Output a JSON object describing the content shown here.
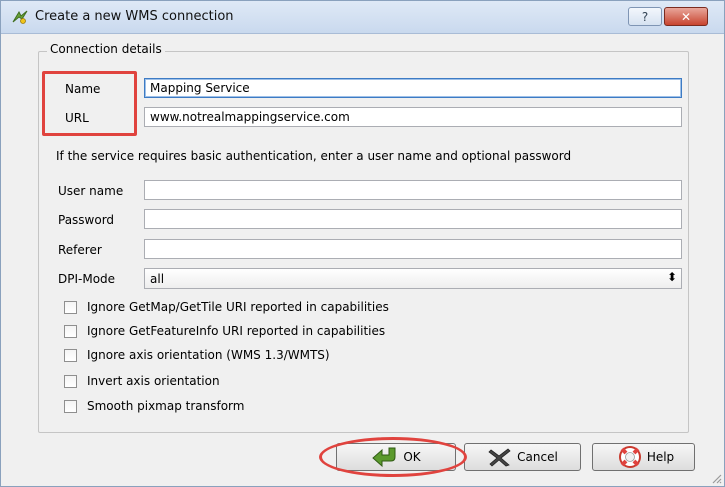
{
  "window": {
    "title": "Create a new WMS connection",
    "help_label": "?",
    "close_label": "✕"
  },
  "group": {
    "title": "Connection details"
  },
  "fields": {
    "name_label": "Name",
    "name_value": "Mapping Service",
    "url_label": "URL",
    "url_value": "www.notrealmappingservice.com",
    "auth_info": "If the service requires basic authentication, enter a user name and optional password",
    "username_label": "User name",
    "username_value": "",
    "password_label": "Password",
    "password_value": "",
    "referer_label": "Referer",
    "referer_value": "",
    "dpi_label": "DPI-Mode",
    "dpi_selected": "all"
  },
  "checkboxes": [
    {
      "label": "Ignore GetMap/GetTile URI reported in capabilities",
      "checked": false
    },
    {
      "label": "Ignore GetFeatureInfo URI reported in capabilities",
      "checked": false
    },
    {
      "label": "Ignore axis orientation (WMS 1.3/WMTS)",
      "checked": false
    },
    {
      "label": "Invert axis orientation",
      "checked": false
    },
    {
      "label": "Smooth pixmap transform",
      "checked": false
    }
  ],
  "buttons": {
    "ok": "OK",
    "cancel": "Cancel",
    "help": "Help"
  },
  "colors": {
    "highlight": "#e0433e",
    "focus_border": "#3d7bc4"
  }
}
